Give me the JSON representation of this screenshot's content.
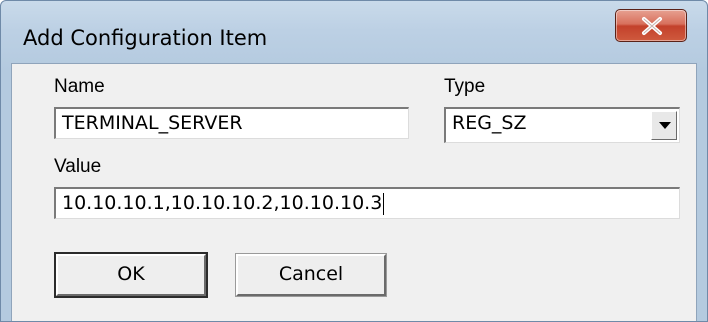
{
  "dialog": {
    "title": "Add Configuration Item",
    "close_label": "X"
  },
  "form": {
    "name_label": "Name",
    "name_value": "TERMINAL_SERVER",
    "type_label": "Type",
    "type_value": "REG_SZ",
    "value_label": "Value",
    "value_value": "10.10.10.1,10.10.10.2,10.10.10.3"
  },
  "buttons": {
    "ok_label": "OK",
    "cancel_label": "Cancel"
  },
  "colors": {
    "close_button": "#c3412b",
    "client_background": "#f0f0f0"
  }
}
